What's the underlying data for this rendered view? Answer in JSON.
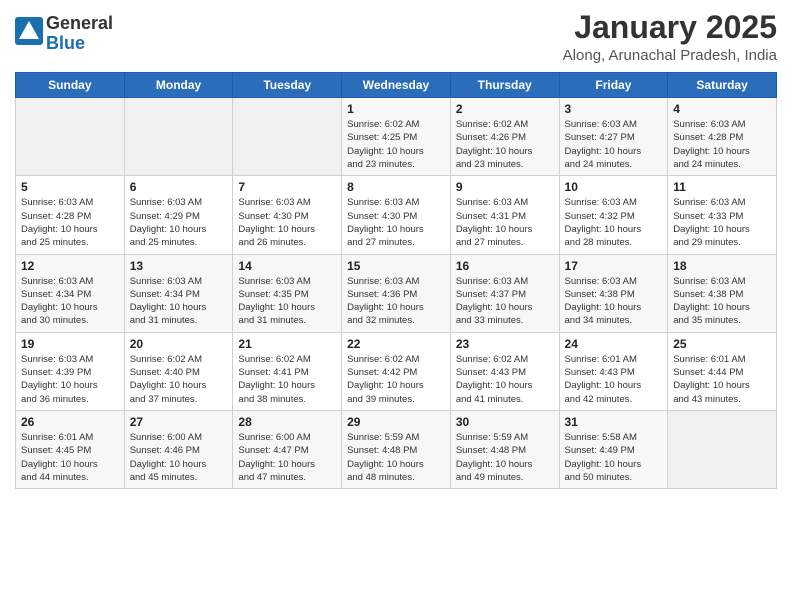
{
  "header": {
    "logo_general": "General",
    "logo_blue": "Blue",
    "month_title": "January 2025",
    "location": "Along, Arunachal Pradesh, India"
  },
  "weekdays": [
    "Sunday",
    "Monday",
    "Tuesday",
    "Wednesday",
    "Thursday",
    "Friday",
    "Saturday"
  ],
  "weeks": [
    [
      {
        "day": "",
        "info": ""
      },
      {
        "day": "",
        "info": ""
      },
      {
        "day": "",
        "info": ""
      },
      {
        "day": "1",
        "info": "Sunrise: 6:02 AM\nSunset: 4:25 PM\nDaylight: 10 hours\nand 23 minutes."
      },
      {
        "day": "2",
        "info": "Sunrise: 6:02 AM\nSunset: 4:26 PM\nDaylight: 10 hours\nand 23 minutes."
      },
      {
        "day": "3",
        "info": "Sunrise: 6:03 AM\nSunset: 4:27 PM\nDaylight: 10 hours\nand 24 minutes."
      },
      {
        "day": "4",
        "info": "Sunrise: 6:03 AM\nSunset: 4:28 PM\nDaylight: 10 hours\nand 24 minutes."
      }
    ],
    [
      {
        "day": "5",
        "info": "Sunrise: 6:03 AM\nSunset: 4:28 PM\nDaylight: 10 hours\nand 25 minutes."
      },
      {
        "day": "6",
        "info": "Sunrise: 6:03 AM\nSunset: 4:29 PM\nDaylight: 10 hours\nand 25 minutes."
      },
      {
        "day": "7",
        "info": "Sunrise: 6:03 AM\nSunset: 4:30 PM\nDaylight: 10 hours\nand 26 minutes."
      },
      {
        "day": "8",
        "info": "Sunrise: 6:03 AM\nSunset: 4:30 PM\nDaylight: 10 hours\nand 27 minutes."
      },
      {
        "day": "9",
        "info": "Sunrise: 6:03 AM\nSunset: 4:31 PM\nDaylight: 10 hours\nand 27 minutes."
      },
      {
        "day": "10",
        "info": "Sunrise: 6:03 AM\nSunset: 4:32 PM\nDaylight: 10 hours\nand 28 minutes."
      },
      {
        "day": "11",
        "info": "Sunrise: 6:03 AM\nSunset: 4:33 PM\nDaylight: 10 hours\nand 29 minutes."
      }
    ],
    [
      {
        "day": "12",
        "info": "Sunrise: 6:03 AM\nSunset: 4:34 PM\nDaylight: 10 hours\nand 30 minutes."
      },
      {
        "day": "13",
        "info": "Sunrise: 6:03 AM\nSunset: 4:34 PM\nDaylight: 10 hours\nand 31 minutes."
      },
      {
        "day": "14",
        "info": "Sunrise: 6:03 AM\nSunset: 4:35 PM\nDaylight: 10 hours\nand 31 minutes."
      },
      {
        "day": "15",
        "info": "Sunrise: 6:03 AM\nSunset: 4:36 PM\nDaylight: 10 hours\nand 32 minutes."
      },
      {
        "day": "16",
        "info": "Sunrise: 6:03 AM\nSunset: 4:37 PM\nDaylight: 10 hours\nand 33 minutes."
      },
      {
        "day": "17",
        "info": "Sunrise: 6:03 AM\nSunset: 4:38 PM\nDaylight: 10 hours\nand 34 minutes."
      },
      {
        "day": "18",
        "info": "Sunrise: 6:03 AM\nSunset: 4:38 PM\nDaylight: 10 hours\nand 35 minutes."
      }
    ],
    [
      {
        "day": "19",
        "info": "Sunrise: 6:03 AM\nSunset: 4:39 PM\nDaylight: 10 hours\nand 36 minutes."
      },
      {
        "day": "20",
        "info": "Sunrise: 6:02 AM\nSunset: 4:40 PM\nDaylight: 10 hours\nand 37 minutes."
      },
      {
        "day": "21",
        "info": "Sunrise: 6:02 AM\nSunset: 4:41 PM\nDaylight: 10 hours\nand 38 minutes."
      },
      {
        "day": "22",
        "info": "Sunrise: 6:02 AM\nSunset: 4:42 PM\nDaylight: 10 hours\nand 39 minutes."
      },
      {
        "day": "23",
        "info": "Sunrise: 6:02 AM\nSunset: 4:43 PM\nDaylight: 10 hours\nand 41 minutes."
      },
      {
        "day": "24",
        "info": "Sunrise: 6:01 AM\nSunset: 4:43 PM\nDaylight: 10 hours\nand 42 minutes."
      },
      {
        "day": "25",
        "info": "Sunrise: 6:01 AM\nSunset: 4:44 PM\nDaylight: 10 hours\nand 43 minutes."
      }
    ],
    [
      {
        "day": "26",
        "info": "Sunrise: 6:01 AM\nSunset: 4:45 PM\nDaylight: 10 hours\nand 44 minutes."
      },
      {
        "day": "27",
        "info": "Sunrise: 6:00 AM\nSunset: 4:46 PM\nDaylight: 10 hours\nand 45 minutes."
      },
      {
        "day": "28",
        "info": "Sunrise: 6:00 AM\nSunset: 4:47 PM\nDaylight: 10 hours\nand 47 minutes."
      },
      {
        "day": "29",
        "info": "Sunrise: 5:59 AM\nSunset: 4:48 PM\nDaylight: 10 hours\nand 48 minutes."
      },
      {
        "day": "30",
        "info": "Sunrise: 5:59 AM\nSunset: 4:48 PM\nDaylight: 10 hours\nand 49 minutes."
      },
      {
        "day": "31",
        "info": "Sunrise: 5:58 AM\nSunset: 4:49 PM\nDaylight: 10 hours\nand 50 minutes."
      },
      {
        "day": "",
        "info": ""
      }
    ]
  ]
}
